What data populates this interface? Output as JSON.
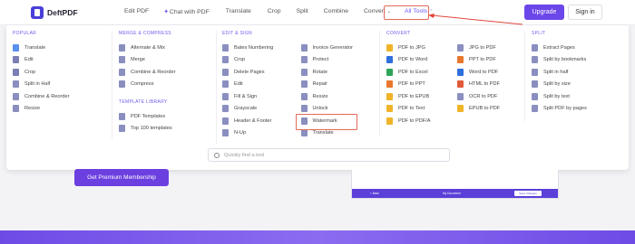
{
  "brand": {
    "name": "DeftPDF"
  },
  "nav": [
    {
      "label": "Edit PDF"
    },
    {
      "label": "Chat with PDF"
    },
    {
      "label": "Translate"
    },
    {
      "label": "Crop"
    },
    {
      "label": "Split"
    },
    {
      "label": "Combine"
    },
    {
      "label": "Convert"
    },
    {
      "label": "All Tools"
    }
  ],
  "actions": {
    "upgrade": "Upgrade",
    "signin": "Sign in"
  },
  "menu": {
    "popular": {
      "title": "POPULAR",
      "items": [
        "Translate",
        "Edit",
        "Crop",
        "Split in Half",
        "Combine & Reorder",
        "Resize"
      ]
    },
    "merge": {
      "title": "MERGE & COMPRESS",
      "items": [
        "Alternate & Mix",
        "Merge",
        "Combine & Reorder",
        "Compress"
      ]
    },
    "templates": {
      "title": "TEMPLATE LIBRARY",
      "items": [
        "PDF Templates",
        "Top 100 templates"
      ]
    },
    "edit": {
      "title": "EDIT & SIGN",
      "col1": [
        "Bates Numbering",
        "Crop",
        "Delete Pages",
        "Edit",
        "Fill & Sign",
        "Grayscale",
        "Header & Footer",
        "N-Up"
      ],
      "col2": [
        "Invoice Generator",
        "Protect",
        "Rotate",
        "Repair",
        "Resize",
        "Unlock",
        "Watermark",
        "Translate"
      ]
    },
    "convert": {
      "title": "CONVERT",
      "col1": [
        "PDF to JPG",
        "PDF to Word",
        "PDF to Excel",
        "PDF to PPT",
        "PDF to EPUB",
        "PDF to Text",
        "PDF to PDF/A"
      ],
      "col2": [
        "JPG to PDF",
        "PPT to PDF",
        "Word to PDF",
        "HTML to PDF",
        "OCR to PDF",
        "EPUB to PDF"
      ]
    },
    "split": {
      "title": "SPLIT",
      "items": [
        "Extract Pages",
        "Split by bookmarks",
        "Split in half",
        "Split by size",
        "Split by text",
        "Split PDF by pages"
      ]
    }
  },
  "search": {
    "placeholder": "Quickly find a tool"
  },
  "page": {
    "premium_button": "Get Premium Membership",
    "preview_back": "< Back",
    "preview_file": "My Document",
    "preview_save": "Save Changes"
  },
  "colors": {
    "accent": "#6b46e8",
    "highlight": "#e36a5a"
  }
}
